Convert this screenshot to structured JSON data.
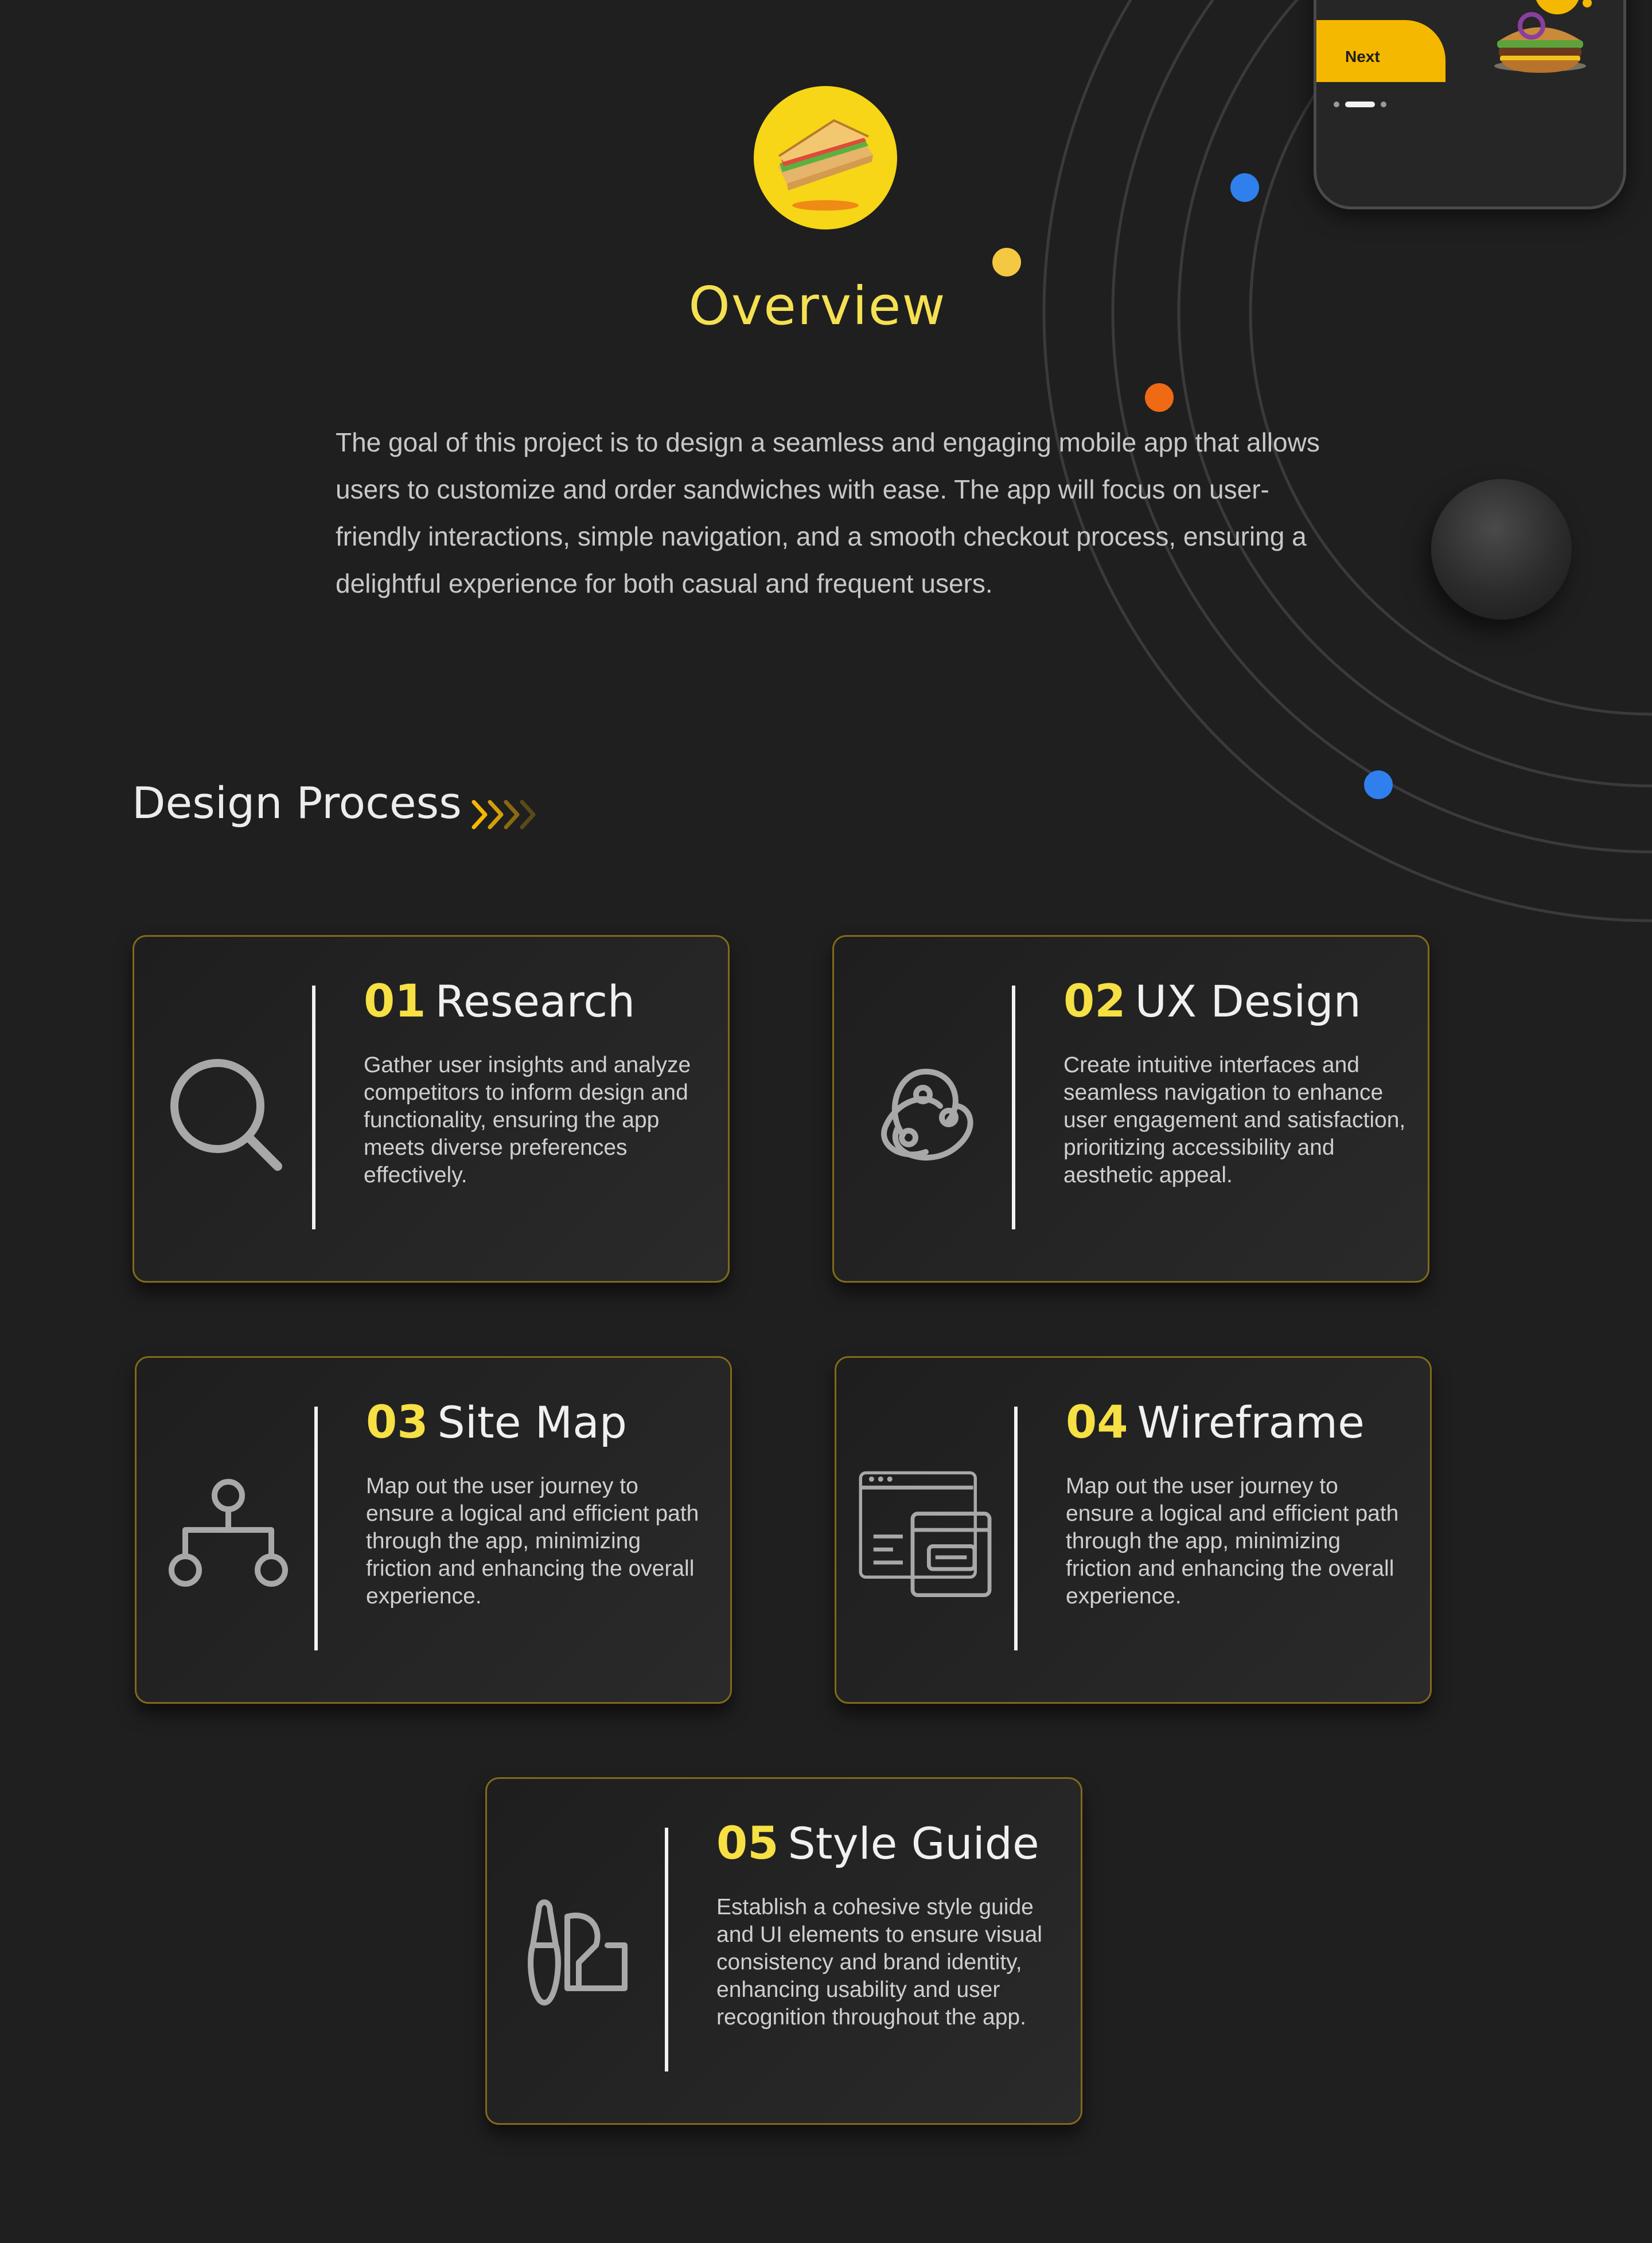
{
  "phone": {
    "next_label": "Next"
  },
  "overview": {
    "title": "Overview",
    "description": "The goal of this project is to design a seamless and engaging mobile app that allows users to customize and order sandwiches with ease. The app will focus on user-friendly interactions, simple navigation, and a smooth checkout process, ensuring a delightful experience for both casual and frequent users."
  },
  "process": {
    "title": "Design Process",
    "cards": [
      {
        "num": "01",
        "title": "Research",
        "icon": "search-icon",
        "desc": "Gather user insights and analyze competitors to inform design and functionality, ensuring the app meets diverse preferences effectively."
      },
      {
        "num": "02",
        "title": "UX Design",
        "icon": "network-icon",
        "desc": "Create intuitive interfaces and seamless navigation to enhance user engagement and satisfaction, prioritizing accessibility and aesthetic appeal."
      },
      {
        "num": "03",
        "title": "Site Map",
        "icon": "sitemap-icon",
        "desc": "Map out the user journey to ensure a logical and efficient path through the app, minimizing friction and enhancing the overall experience."
      },
      {
        "num": "04",
        "title": "Wireframe",
        "icon": "wireframe-icon",
        "desc": "Map out the user journey to ensure a logical and efficient path through the app, minimizing friction and enhancing the overall experience."
      },
      {
        "num": "05",
        "title": "Style Guide",
        "icon": "style-guide-icon",
        "desc": "Establish a cohesive style guide and UI elements to ensure visual consistency and brand identity, enhancing usability and user recognition throughout the app."
      }
    ]
  },
  "colors": {
    "background": "#1f1f1f",
    "accent_yellow": "#f6e044",
    "card_border": "#7f6a1a",
    "dot_blue": "#2f80ed",
    "dot_orange": "#f06a16",
    "dot_yellow": "#f5c842"
  }
}
